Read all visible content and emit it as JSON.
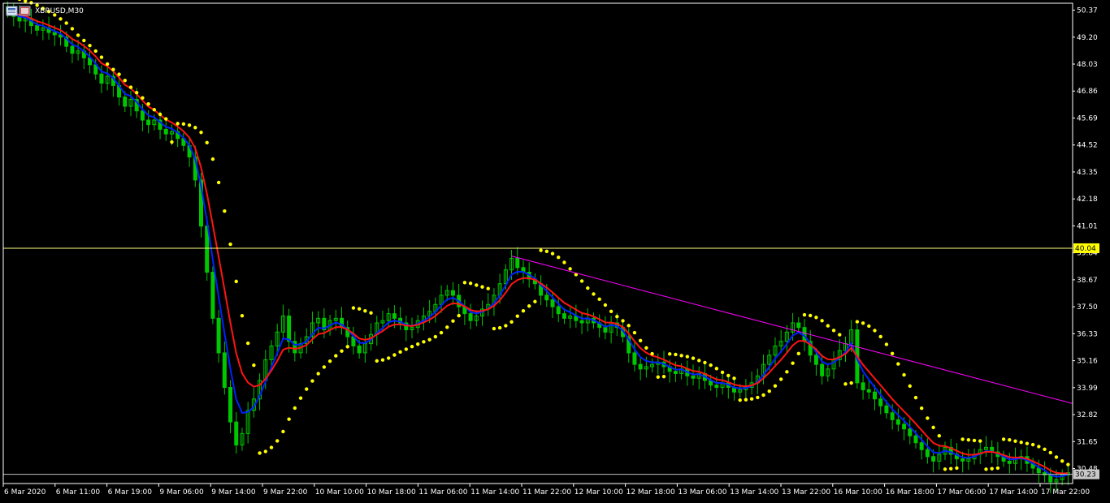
{
  "window": {
    "symbol_label": "XBRUSD,M30",
    "icon": "chart-window-icon",
    "colors": {
      "background": "#000000",
      "frame": "#ffffff",
      "candle": "#00c800",
      "ma_fast": "#0022ff",
      "ma_slow": "#ff1414",
      "sar": "#ffff00",
      "trendline": "#ff00ff",
      "hline": "#ffff80",
      "price_tag_high": "#ffff00",
      "price_tag_low": "#c8c8c8"
    }
  },
  "chart_data": {
    "type": "candlestick",
    "title": "XBRUSD,M30",
    "xlabel": "",
    "ylabel": "",
    "ylim": [
      29.9,
      50.6
    ],
    "y_ticks": [
      50.37,
      49.2,
      48.03,
      46.86,
      45.69,
      44.52,
      43.35,
      42.18,
      41.01,
      39.84,
      38.67,
      37.5,
      36.33,
      35.16,
      33.99,
      32.82,
      31.65,
      30.48
    ],
    "x_ticks": [
      "6 Mar 2020",
      "6 Mar 11:00",
      "6 Mar 19:00",
      "9 Mar 06:00",
      "9 Mar 14:00",
      "9 Mar 22:00",
      "10 Mar 10:00",
      "10 Mar 18:00",
      "11 Mar 06:00",
      "11 Mar 14:00",
      "11 Mar 22:00",
      "12 Mar 10:00",
      "12 Mar 18:00",
      "13 Mar 06:00",
      "13 Mar 14:00",
      "13 Mar 22:00",
      "16 Mar 10:00",
      "16 Mar 18:00",
      "17 Mar 06:00",
      "17 Mar 14:00",
      "17 Mar 22:00"
    ],
    "price_levels": [
      {
        "label": "40.04",
        "value": 40.04
      },
      {
        "label": "30.23",
        "value": 30.23
      }
    ],
    "close_series": [
      50.3,
      50.1,
      49.9,
      50.0,
      49.7,
      49.5,
      49.6,
      49.4,
      49.3,
      49.2,
      48.8,
      48.5,
      48.6,
      48.3,
      48.0,
      47.6,
      47.2,
      47.5,
      47.1,
      46.6,
      46.2,
      46.5,
      46.0,
      45.6,
      45.4,
      45.6,
      45.2,
      45.0,
      45.1,
      44.8,
      44.5,
      44.0,
      43.0,
      41.0,
      39.0,
      37.0,
      35.5,
      34.0,
      32.5,
      31.5,
      32.0,
      33.0,
      33.5,
      34.3,
      35.2,
      35.8,
      36.4,
      37.1,
      36.0,
      35.5,
      35.9,
      36.2,
      36.8,
      37.0,
      36.5,
      36.9,
      37.0,
      36.6,
      36.2,
      35.8,
      35.5,
      35.9,
      36.3,
      36.8,
      36.9,
      37.2,
      37.0,
      36.8,
      36.5,
      36.6,
      36.9,
      37.1,
      37.3,
      37.6,
      38.0,
      38.2,
      38.0,
      37.5,
      37.2,
      36.9,
      37.1,
      37.4,
      37.6,
      38.0,
      38.5,
      39.1,
      39.6,
      39.2,
      39.0,
      38.7,
      38.5,
      38.0,
      37.8,
      37.5,
      37.2,
      37.0,
      37.1,
      36.9,
      36.8,
      37.0,
      36.8,
      36.6,
      36.4,
      36.8,
      36.6,
      36.2,
      35.5,
      35.0,
      34.8,
      34.9,
      35.0,
      35.1,
      34.9,
      34.7,
      34.6,
      34.8,
      34.5,
      34.4,
      34.6,
      34.3,
      34.1,
      34.0,
      34.2,
      34.0,
      33.8,
      33.9,
      34.0,
      34.2,
      34.5,
      35.0,
      35.4,
      35.8,
      36.0,
      36.4,
      36.8,
      36.6,
      36.0,
      35.4,
      35.0,
      34.5,
      34.8,
      35.2,
      35.6,
      35.9,
      36.5,
      34.2,
      33.9,
      33.8,
      33.5,
      33.2,
      32.9,
      32.6,
      32.4,
      32.2,
      31.9,
      31.6,
      31.3,
      31.0,
      30.8,
      31.1,
      31.4,
      31.1,
      30.9,
      30.8,
      30.9,
      31.1,
      31.3,
      31.4,
      31.2,
      31.0,
      30.8,
      30.7,
      30.9,
      31.0,
      30.7,
      30.5,
      30.3,
      30.2,
      29.9,
      30.0,
      30.2,
      30.3
    ]
  }
}
